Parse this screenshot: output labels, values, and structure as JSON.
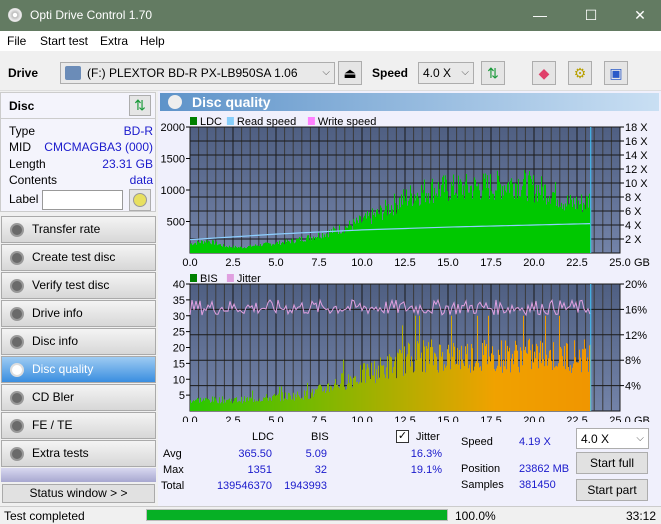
{
  "window": {
    "title": "Opti Drive Control 1.70",
    "minimize": "—",
    "maximize": "☐",
    "close": "✕"
  },
  "menu": [
    "File",
    "Start test",
    "Extra",
    "Help"
  ],
  "toolbar": {
    "drive_label": "Drive",
    "drive_value": "(F:)  PLEXTOR BD-R  PX-LB950SA 1.06",
    "speed_label": "Speed",
    "speed_value": "4.0 X"
  },
  "disc": {
    "title": "Disc",
    "type_k": "Type",
    "type_v": "BD-R",
    "mid_k": "MID",
    "mid_v": "CMCMAGBA3 (000)",
    "length_k": "Length",
    "length_v": "23.31 GB",
    "contents_k": "Contents",
    "contents_v": "data",
    "label_k": "Label",
    "label_v": ""
  },
  "nav": [
    "Transfer rate",
    "Create test disc",
    "Verify test disc",
    "Drive info",
    "Disc info",
    "Disc quality",
    "CD Bler",
    "FE / TE",
    "Extra tests"
  ],
  "nav_active": 5,
  "status_window": "Status window > >",
  "main": {
    "title": "Disc quality"
  },
  "chart_data": [
    {
      "type": "area",
      "legend": [
        "LDC",
        "Read speed",
        "Write speed"
      ],
      "legend_colors": [
        "#008000",
        "#87cefa",
        "#ff80ff"
      ],
      "x_ticks": [
        "0.0",
        "2.5",
        "5.0",
        "7.5",
        "10.0",
        "12.5",
        "15.0",
        "17.5",
        "20.0",
        "22.5",
        "25.0"
      ],
      "x_unit": "GB",
      "xlim": [
        0,
        25
      ],
      "y_ticks": [
        "500",
        "1000",
        "1500",
        "2000"
      ],
      "ylim": [
        0,
        2000
      ],
      "y2_ticks": [
        "2 X",
        "4 X",
        "6 X",
        "8 X",
        "10 X",
        "12 X",
        "14 X",
        "16 X",
        "18 X"
      ],
      "y2lim": [
        0,
        18
      ],
      "ldc_profile": [
        [
          0,
          150
        ],
        [
          1,
          200
        ],
        [
          2,
          110
        ],
        [
          3,
          90
        ],
        [
          4,
          130
        ],
        [
          5,
          160
        ],
        [
          6,
          200
        ],
        [
          7,
          260
        ],
        [
          8,
          330
        ],
        [
          9,
          420
        ],
        [
          10,
          520
        ],
        [
          11,
          650
        ],
        [
          12,
          820
        ],
        [
          13,
          960
        ],
        [
          14,
          1040
        ],
        [
          15,
          1050
        ],
        [
          16,
          1060
        ],
        [
          17,
          1080
        ],
        [
          18,
          1100
        ],
        [
          19,
          1150
        ],
        [
          20,
          1060
        ],
        [
          21,
          1000
        ],
        [
          22,
          800
        ],
        [
          23,
          820
        ],
        [
          23.3,
          900
        ]
      ],
      "read_speed": [
        [
          0,
          1.9
        ],
        [
          5,
          2.7
        ],
        [
          10,
          3.3
        ],
        [
          15,
          3.7
        ],
        [
          20,
          4.0
        ],
        [
          23.3,
          4.2
        ]
      ]
    },
    {
      "type": "area",
      "legend": [
        "BIS",
        "Jitter"
      ],
      "legend_colors": [
        "#008000",
        "#e0a0e0"
      ],
      "x_ticks": [
        "0.0",
        "2.5",
        "5.0",
        "7.5",
        "10.0",
        "12.5",
        "15.0",
        "17.5",
        "20.0",
        "22.5",
        "25.0"
      ],
      "x_unit": "GB",
      "xlim": [
        0,
        25
      ],
      "y_ticks": [
        "5",
        "10",
        "15",
        "20",
        "25",
        "30",
        "35",
        "40"
      ],
      "ylim": [
        0,
        40
      ],
      "y2_ticks": [
        "4%",
        "8%",
        "12%",
        "16%",
        "20%"
      ],
      "y2lim": [
        0,
        20
      ],
      "bis_profile": [
        [
          0,
          4
        ],
        [
          3,
          4
        ],
        [
          5,
          5
        ],
        [
          7,
          6
        ],
        [
          8.5,
          10
        ],
        [
          10,
          13
        ],
        [
          12,
          17
        ],
        [
          13,
          20
        ],
        [
          23.3,
          20
        ]
      ],
      "jitter_avg": 16.3
    }
  ],
  "stats": {
    "col_ldc": "LDC",
    "col_bis": "BIS",
    "jitter_label": "Jitter",
    "jitter_checked": true,
    "avg_k": "Avg",
    "avg_ldc": "365.50",
    "avg_bis": "5.09",
    "avg_jitter": "16.3%",
    "max_k": "Max",
    "max_ldc": "1351",
    "max_bis": "32",
    "max_jitter": "19.1%",
    "total_k": "Total",
    "total_ldc": "139546370",
    "total_bis": "1943993",
    "speed_k": "Speed",
    "speed_v": "4.19 X",
    "position_k": "Position",
    "position_v": "23862 MB",
    "samples_k": "Samples",
    "samples_v": "381450",
    "speed_select": "4.0 X",
    "start_full": "Start full",
    "start_part": "Start part"
  },
  "statusbar": {
    "text": "Test completed",
    "progress": 100.0,
    "progress_text": "100.0%",
    "time": "33:12"
  }
}
